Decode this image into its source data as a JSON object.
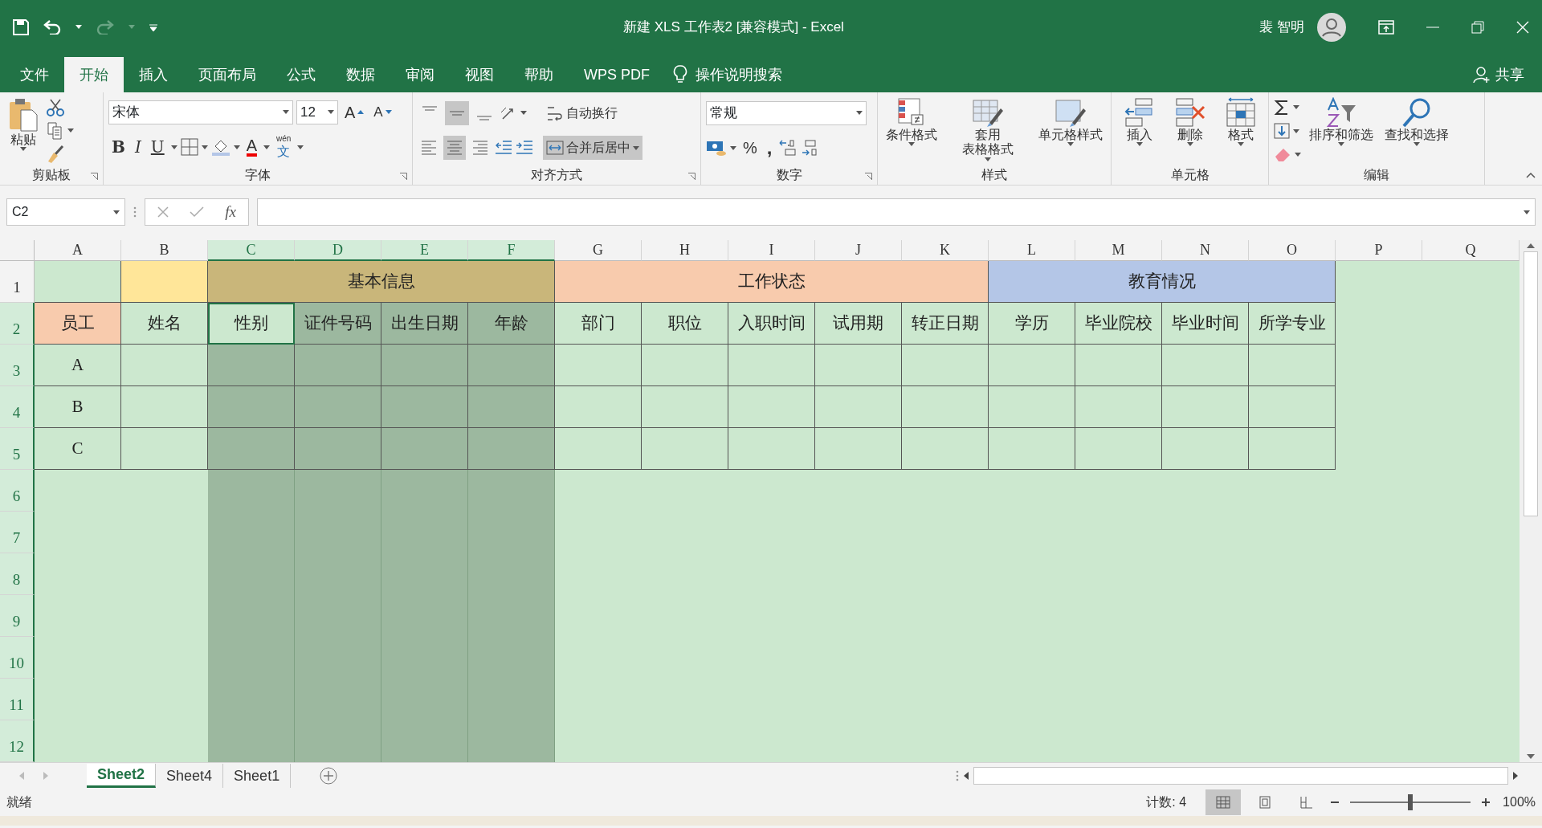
{
  "window": {
    "title": "新建 XLS 工作表2  [兼容模式]  -  Excel",
    "user": "裴 智明"
  },
  "menu_tabs": [
    {
      "label": "文件",
      "selected": false
    },
    {
      "label": "开始",
      "selected": true
    },
    {
      "label": "插入",
      "selected": false
    },
    {
      "label": "页面布局",
      "selected": false
    },
    {
      "label": "公式",
      "selected": false
    },
    {
      "label": "数据",
      "selected": false
    },
    {
      "label": "审阅",
      "selected": false
    },
    {
      "label": "视图",
      "selected": false
    },
    {
      "label": "帮助",
      "selected": false
    },
    {
      "label": "WPS PDF",
      "selected": false
    }
  ],
  "tell_me": "操作说明搜索",
  "share": "共享",
  "ribbon_groups": [
    {
      "kind": "clipboard",
      "title": "剪贴板",
      "launcher": true,
      "paste": "粘贴"
    },
    {
      "kind": "font",
      "title": "字体",
      "launcher": true,
      "font_name": "宋体",
      "font_size": "12",
      "grow": "A",
      "shrink": "A",
      "styles": [
        "B",
        "I",
        "U"
      ],
      "font_color": "A",
      "phonetic_top": "wén",
      "phonetic": "文"
    },
    {
      "kind": "alignment",
      "title": "对齐方式",
      "launcher": true,
      "vertical": [
        {
          "selected": false
        },
        {
          "selected": true
        },
        {
          "selected": false
        }
      ],
      "horizontal": [
        {
          "selected": false
        },
        {
          "selected": true
        },
        {
          "selected": false
        }
      ],
      "wrap": "自动换行",
      "merge": {
        "label": "合并后居中",
        "selected": true
      }
    },
    {
      "kind": "number",
      "title": "数字",
      "launcher": true,
      "format": "常规",
      "percent": "%",
      "comma": ","
    },
    {
      "kind": "styles",
      "title": "样式",
      "launcher": false,
      "buttons": [
        {
          "lines": [
            "条件格式"
          ]
        },
        {
          "lines": [
            "套用",
            "表格格式"
          ]
        },
        {
          "lines": [
            "单元格样式"
          ]
        }
      ]
    },
    {
      "kind": "cells",
      "title": "单元格",
      "launcher": false,
      "buttons": [
        {
          "lines": [
            "插入"
          ]
        },
        {
          "lines": [
            "删除"
          ]
        },
        {
          "lines": [
            "格式"
          ]
        }
      ]
    },
    {
      "kind": "editing",
      "title": "编辑",
      "launcher": false,
      "buttons": [
        {
          "lines": [
            "排序和筛选"
          ]
        },
        {
          "lines": [
            "查找和选择"
          ]
        }
      ]
    }
  ],
  "formula_bar": {
    "name_box": "C2",
    "fx": "fx"
  },
  "columns": [
    {
      "label": "A",
      "selected": false
    },
    {
      "label": "B",
      "selected": false
    },
    {
      "label": "C",
      "selected": true
    },
    {
      "label": "D",
      "selected": true
    },
    {
      "label": "E",
      "selected": true
    },
    {
      "label": "F",
      "selected": true
    },
    {
      "label": "G",
      "selected": false
    },
    {
      "label": "H",
      "selected": false
    },
    {
      "label": "I",
      "selected": false
    },
    {
      "label": "J",
      "selected": false
    },
    {
      "label": "K",
      "selected": false
    },
    {
      "label": "L",
      "selected": false
    },
    {
      "label": "M",
      "selected": false
    },
    {
      "label": "N",
      "selected": false
    },
    {
      "label": "O",
      "selected": false
    },
    {
      "label": "P",
      "selected": false
    },
    {
      "label": "Q",
      "selected": false
    }
  ],
  "rows": [
    {
      "label": "1",
      "selected": false,
      "cells": [
        {},
        {
          "color": "#ffe699"
        },
        {
          "text": "基本信息",
          "color": "#c9b67a"
        },
        {
          "kind": "merged"
        },
        {
          "kind": "merged"
        },
        {
          "kind": "merged"
        },
        {
          "text": "工作状态",
          "color": "#f8cbad"
        },
        {
          "kind": "merged"
        },
        {
          "kind": "merged"
        },
        {
          "kind": "merged"
        },
        {
          "kind": "merged"
        },
        {
          "text": "教育情况",
          "color": "#b4c6e7"
        },
        {
          "kind": "merged"
        },
        {
          "kind": "merged"
        },
        {
          "kind": "merged"
        }
      ]
    },
    {
      "label": "2",
      "selected": true,
      "cells": [
        {
          "text": "员工",
          "color": "#f8cbad"
        },
        {
          "text": "姓名"
        },
        {
          "text": "性别",
          "active": true
        },
        {
          "text": "证件号码"
        },
        {
          "text": "出生日期"
        },
        {
          "text": "年龄"
        },
        {
          "text": "部门"
        },
        {
          "text": "职位"
        },
        {
          "text": "入职时间"
        },
        {
          "text": "试用期"
        },
        {
          "text": "转正日期"
        },
        {
          "text": "学历"
        },
        {
          "text": "毕业院校"
        },
        {
          "text": "毕业时间"
        },
        {
          "text": "所学专业"
        }
      ]
    },
    {
      "label": "3",
      "selected": true,
      "cells": [
        {
          "text": "A"
        },
        {},
        {},
        {},
        {},
        {},
        {},
        {},
        {},
        {},
        {},
        {},
        {},
        {},
        {}
      ]
    },
    {
      "label": "4",
      "selected": true,
      "cells": [
        {
          "text": "B"
        },
        {},
        {},
        {},
        {},
        {},
        {},
        {},
        {},
        {},
        {},
        {},
        {},
        {},
        {}
      ]
    },
    {
      "label": "5",
      "selected": true,
      "cells": [
        {
          "text": "C"
        },
        {},
        {},
        {},
        {},
        {},
        {},
        {},
        {},
        {},
        {},
        {},
        {},
        {},
        {}
      ]
    },
    {
      "label": "6",
      "selected": true
    },
    {
      "label": "7",
      "selected": true
    },
    {
      "label": "8",
      "selected": true
    },
    {
      "label": "9",
      "selected": true
    },
    {
      "label": "10",
      "selected": true
    },
    {
      "label": "11",
      "selected": true
    },
    {
      "label": "12",
      "selected": true
    }
  ],
  "sheets": [
    {
      "label": "Sheet2",
      "selected": true
    },
    {
      "label": "Sheet4",
      "selected": false
    },
    {
      "label": "Sheet1",
      "selected": false
    }
  ],
  "status_bar": {
    "ready": "就绪",
    "count": "计数: 4",
    "views": [
      {
        "selected": true
      },
      {
        "selected": false
      },
      {
        "selected": false
      }
    ],
    "zoom": "100%",
    "zoom_slider": {
      "level": 0.5
    }
  }
}
